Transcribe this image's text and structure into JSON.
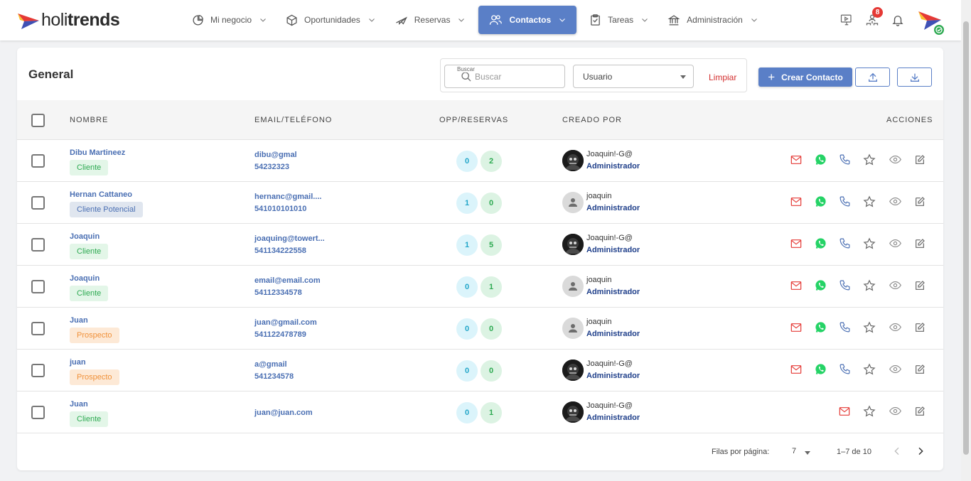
{
  "brand": {
    "prefix": "holi",
    "bold": "trends"
  },
  "nav": [
    {
      "label": "Mi negocio",
      "icon": "pie-chart-icon"
    },
    {
      "label": "Oportunidades",
      "icon": "cube-icon"
    },
    {
      "label": "Reservas",
      "icon": "airplane-icon"
    },
    {
      "label": "Contactos",
      "icon": "users-icon",
      "active": true
    },
    {
      "label": "Tareas",
      "icon": "clipboard-check-icon"
    },
    {
      "label": "Administración",
      "icon": "bank-icon"
    }
  ],
  "header_icons": {
    "notifications_count": "8"
  },
  "colors": {
    "accent": "#5a7fc7",
    "link": "#4a6fb3",
    "danger": "#d32f2f",
    "whatsapp": "#25d366"
  },
  "page": {
    "title": "General"
  },
  "filters": {
    "search_legend": "Buscar",
    "search_placeholder": "Buscar",
    "user_select": "Usuario",
    "clear": "Limpiar"
  },
  "actions": {
    "create": "Crear Contacto"
  },
  "table": {
    "headers": {
      "name": "NOMBRE",
      "email": "EMAIL/TELÉFONO",
      "opp": "OPP/RESERVAS",
      "creator": "CREADO POR",
      "actions": "ACCIONES"
    },
    "rows": [
      {
        "name": "Dibu Martineez",
        "tag": "Cliente",
        "tag_type": "cliente",
        "email": "dibu@gmal",
        "phone": "54232323",
        "opp": "0",
        "res": "2",
        "creator": "Joaquin!-G@",
        "role": "Administrador",
        "avatar": "photo",
        "has_phone": true
      },
      {
        "name": "Hernan Cattaneo",
        "tag": "Cliente Potencial",
        "tag_type": "potencial",
        "email": "hernanc@gmail....",
        "phone": "541010101010",
        "opp": "1",
        "res": "0",
        "creator": "joaquin",
        "role": "Administrador",
        "avatar": "gray",
        "has_phone": true
      },
      {
        "name": "Joaquin",
        "tag": "Cliente",
        "tag_type": "cliente",
        "email": "joaquing@towert...",
        "phone": "541134222558",
        "opp": "1",
        "res": "5",
        "creator": "Joaquin!-G@",
        "role": "Administrador",
        "avatar": "photo",
        "has_phone": true
      },
      {
        "name": "Joaquin",
        "tag": "Cliente",
        "tag_type": "cliente",
        "email": "email@email.com",
        "phone": "54112334578",
        "opp": "0",
        "res": "1",
        "creator": "joaquin",
        "role": "Administrador",
        "avatar": "gray",
        "has_phone": true
      },
      {
        "name": "Juan",
        "tag": "Prospecto",
        "tag_type": "prospecto",
        "email": "juan@gmail.com",
        "phone": "541122478789",
        "opp": "0",
        "res": "0",
        "creator": "joaquin",
        "role": "Administrador",
        "avatar": "gray",
        "has_phone": true
      },
      {
        "name": "juan",
        "tag": "Prospecto",
        "tag_type": "prospecto",
        "email": "a@gmail",
        "phone": "541234578",
        "opp": "0",
        "res": "0",
        "creator": "Joaquin!-G@",
        "role": "Administrador",
        "avatar": "photo",
        "has_phone": true
      },
      {
        "name": "Juan",
        "tag": "Cliente",
        "tag_type": "cliente",
        "email": "juan@juan.com",
        "phone": "",
        "opp": "0",
        "res": "1",
        "creator": "Joaquin!-G@",
        "role": "Administrador",
        "avatar": "photo",
        "has_phone": false
      }
    ]
  },
  "pagination": {
    "label": "Filas por página:",
    "rows_per_page": "7",
    "range": "1–7 de 10"
  }
}
